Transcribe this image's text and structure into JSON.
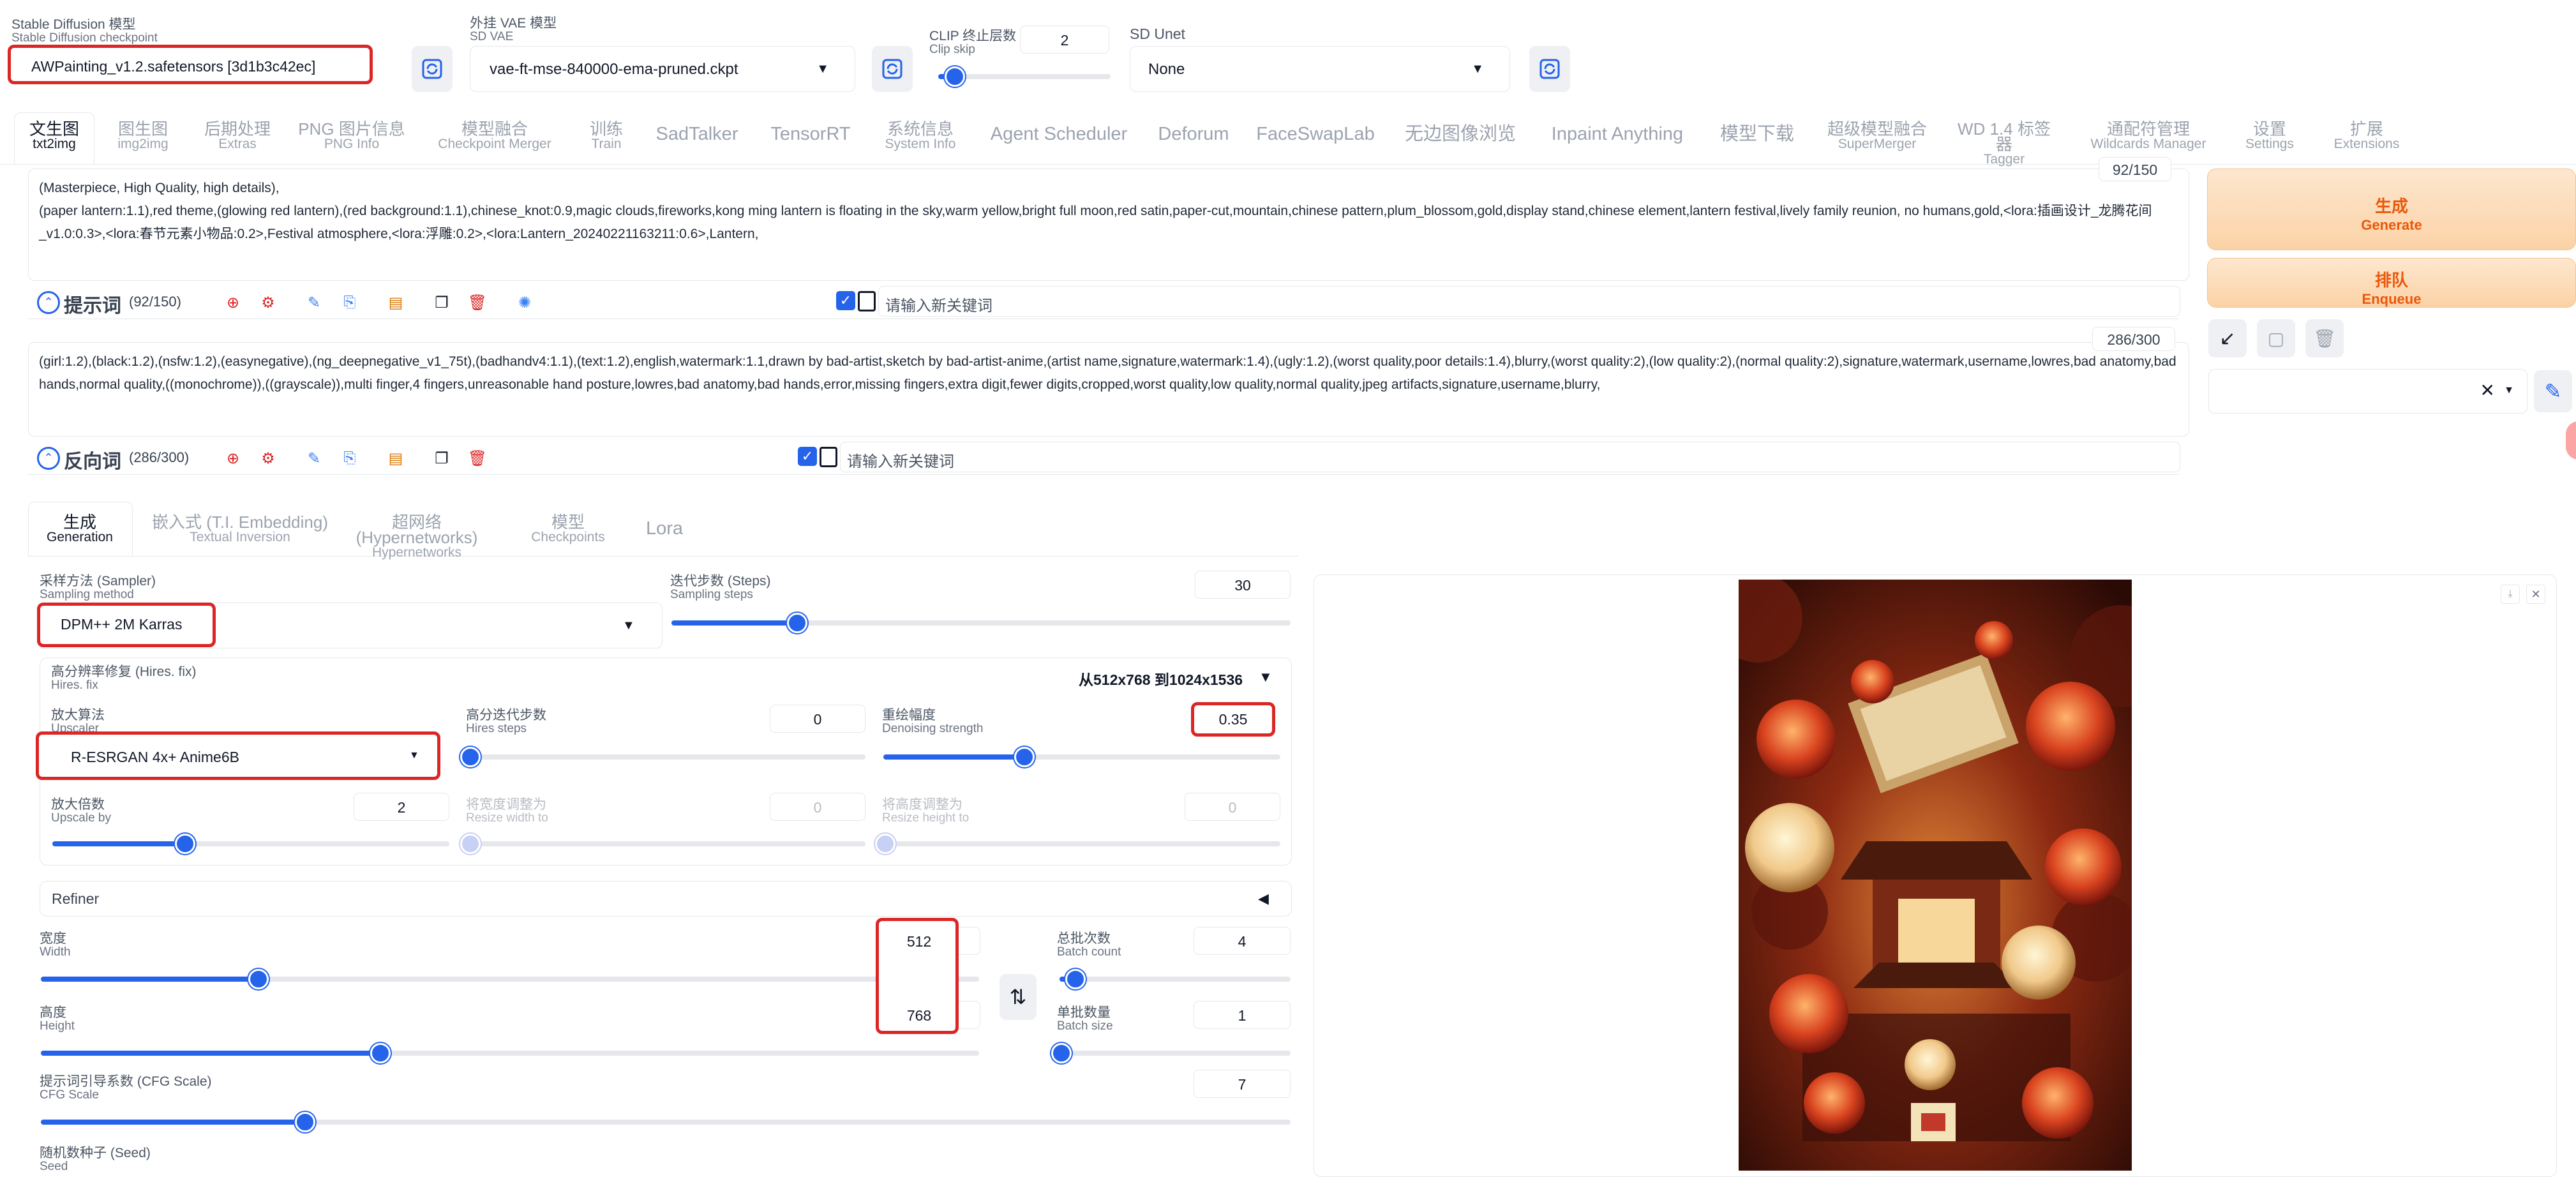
{
  "header": {
    "sd_model": {
      "label_cn": "Stable Diffusion 模型",
      "label_en": "Stable Diffusion checkpoint",
      "value": "AWPainting_v1.2.safetensors [3d1b3c42ec]"
    },
    "vae": {
      "label_cn": "外挂 VAE 模型",
      "label_en": "SD VAE",
      "value": "vae-ft-mse-840000-ema-pruned.ckpt"
    },
    "clip_skip": {
      "label_cn": "CLIP 终止层数",
      "label_en": "Clip skip",
      "value": "2"
    },
    "unet": {
      "label": "SD Unet",
      "value": "None"
    }
  },
  "tabs": [
    {
      "cn": "文生图",
      "en": "txt2img"
    },
    {
      "cn": "图生图",
      "en": "img2img"
    },
    {
      "cn": "后期处理",
      "en": "Extras"
    },
    {
      "cn": "PNG 图片信息",
      "en": "PNG Info"
    },
    {
      "cn": "模型融合",
      "en": "Checkpoint Merger"
    },
    {
      "cn": "训练",
      "en": "Train"
    },
    {
      "cn": "SadTalker",
      "en": ""
    },
    {
      "cn": "TensorRT",
      "en": ""
    },
    {
      "cn": "系统信息",
      "en": "System Info"
    },
    {
      "cn": "Agent Scheduler",
      "en": ""
    },
    {
      "cn": "Deforum",
      "en": ""
    },
    {
      "cn": "FaceSwapLab",
      "en": ""
    },
    {
      "cn": "无边图像浏览",
      "en": ""
    },
    {
      "cn": "Inpaint Anything",
      "en": ""
    },
    {
      "cn": "模型下载",
      "en": ""
    },
    {
      "cn": "超级模型融合",
      "en": "SuperMerger"
    },
    {
      "cn": "WD 1.4 标签器",
      "en": "Tagger"
    },
    {
      "cn": "通配符管理",
      "en": "Wildcards Manager"
    },
    {
      "cn": "设置",
      "en": "Settings"
    },
    {
      "cn": "扩展",
      "en": "Extensions"
    }
  ],
  "prompt": {
    "token_count": "92/150",
    "text": "(Masterpiece, High Quality, high details),\n(paper lantern:1.1),red theme,(glowing red lantern),(red background:1.1),chinese_knot:0.9,magic clouds,fireworks,kong ming lantern is floating in the sky,warm yellow,bright full moon,red satin,paper-cut,mountain,chinese pattern,plum_blossom,gold,display stand,chinese element,lantern festival,lively family reunion, no humans,gold,<lora:插画设计_龙腾花间_v1.0:0.3>,<lora:春节元素小物品:0.2>,Festival atmosphere,<lora:浮雕:0.2>,<lora:Lantern_20240221163211:0.6>,Lantern,",
    "label": "提示词",
    "count_label": "(92/150)",
    "keyword_placeholder": "请输入新关键词"
  },
  "negative": {
    "token_count": "286/300",
    "text": "(girl:1.2),(black:1.2),(nsfw:1.2),(easynegative),(ng_deepnegative_v1_75t),(badhandv4:1.1),(text:1.2),english,watermark:1.1,drawn by bad-artist,sketch by bad-artist-anime,(artist name,signature,watermark:1.4),(ugly:1.2),(worst quality,poor details:1.4),blurry,(worst quality:2),(low quality:2),(normal quality:2),signature,watermark,username,lowres,bad anatomy,bad hands,normal quality,((monochrome)),((grayscale)),multi finger,4 fingers,unreasonable hand posture,lowres,bad anatomy,bad hands,error,missing fingers,extra digit,fewer digits,cropped,worst quality,low quality,normal quality,jpeg artifacts,signature,username,blurry,",
    "label": "反向词",
    "count_label": "(286/300)",
    "keyword_placeholder": "请输入新关键词"
  },
  "actions": {
    "generate_cn": "生成",
    "generate_en": "Generate",
    "enqueue_cn": "排队",
    "enqueue_en": "Enqueue"
  },
  "subtabs": [
    {
      "cn": "生成",
      "en": "Generation"
    },
    {
      "cn": "嵌入式 (T.I. Embedding)",
      "en": "Textual Inversion"
    },
    {
      "cn": "超网络 (Hypernetworks)",
      "en": "Hypernetworks"
    },
    {
      "cn": "模型",
      "en": "Checkpoints"
    },
    {
      "cn": "Lora",
      "en": ""
    }
  ],
  "sampler": {
    "label_cn": "采样方法 (Sampler)",
    "label_en": "Sampling method",
    "value": "DPM++ 2M Karras"
  },
  "steps": {
    "label_cn": "迭代步数 (Steps)",
    "label_en": "Sampling steps",
    "value": "30",
    "fraction": 0.2
  },
  "hires": {
    "label_cn": "高分辨率修复 (Hires. fix)",
    "label_en": "Hires. fix",
    "info": "从512x768 到1024x1536",
    "upscaler": {
      "label_cn": "放大算法",
      "label_en": "Upscaler",
      "value": "R-ESRGAN 4x+ Anime6B"
    },
    "hires_steps": {
      "label_cn": "高分迭代步数",
      "label_en": "Hires steps",
      "value": "0",
      "fraction": 0.0
    },
    "denoise": {
      "label_cn": "重绘幅度",
      "label_en": "Denoising strength",
      "value": "0.35",
      "fraction": 0.35
    },
    "upscale_by": {
      "label_cn": "放大倍数",
      "label_en": "Upscale by",
      "value": "2",
      "fraction": 0.33
    },
    "resize_w": {
      "label_cn": "将宽度调整为",
      "label_en": "Resize width to",
      "value": "0",
      "fraction": 0.0
    },
    "resize_h": {
      "label_cn": "将高度调整为",
      "label_en": "Resize height to",
      "value": "0",
      "fraction": 0.0
    }
  },
  "refiner": {
    "label": "Refiner"
  },
  "width": {
    "label_cn": "宽度",
    "label_en": "Width",
    "value": "512",
    "fraction": 0.23
  },
  "height": {
    "label_cn": "高度",
    "label_en": "Height",
    "value": "768",
    "fraction": 0.36
  },
  "batch_count": {
    "label_cn": "总批次数",
    "label_en": "Batch count",
    "value": "4",
    "fraction": 0.06
  },
  "batch_size": {
    "label_cn": "单批数量",
    "label_en": "Batch size",
    "value": "1",
    "fraction": 0.0
  },
  "cfg": {
    "label_cn": "提示词引导系数 (CFG Scale)",
    "label_en": "CFG Scale",
    "value": "7",
    "fraction": 0.21
  },
  "seed": {
    "label_cn": "随机数种子 (Seed)",
    "label_en": "Seed"
  },
  "colors": {
    "accent": "#2563eb",
    "highlight": "#dc2626",
    "generate": "#ea580c"
  }
}
